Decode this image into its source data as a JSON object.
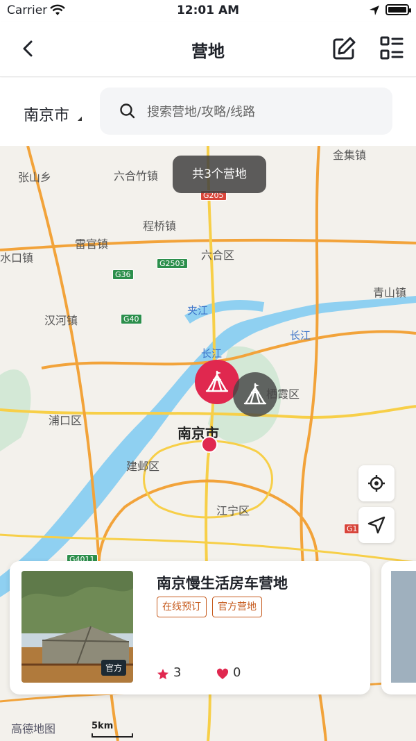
{
  "status": {
    "carrier": "Carrier",
    "time": "12:01 AM"
  },
  "nav": {
    "title": "营地",
    "back_icon": "chevron-left-icon",
    "edit_icon": "edit-icon",
    "list_icon": "list-view-icon"
  },
  "filter": {
    "city": "南京市",
    "search_placeholder": "搜索营地/攻略/线路"
  },
  "map": {
    "count_label": "共3个营地",
    "labels": {
      "jinji": "金集镇",
      "zhangshan": "张山乡",
      "liuhezhu": "六合竹镇",
      "chengqiao": "程桥镇",
      "leiguan": "雷官镇",
      "liuhequ": "六合区",
      "shuikou": "水口镇",
      "qingshan": "青山镇",
      "hanhe": "汉河镇",
      "jiajiang": "夹江",
      "changjiang1": "长江",
      "changjiang2": "长江",
      "qixia": "栖霞区",
      "pukou": "浦口区",
      "nanjing": "南京市",
      "jianye": "建邺区",
      "jiangning": "江宁区"
    },
    "highways": {
      "g205": "G205",
      "g2503": "G2503",
      "g36": "G36",
      "g40": "G40",
      "g1": "G1",
      "g4011": "G4011"
    },
    "attribution": "高德地图",
    "scale": "5km",
    "marker_colors": {
      "primary": "#e0284f",
      "secondary": "#464646"
    }
  },
  "card": {
    "name": "南京慢生活房车营地",
    "tags": [
      "在线预订",
      "官方营地"
    ],
    "photo_badge": "官方",
    "rating": "3",
    "likes": "0"
  }
}
